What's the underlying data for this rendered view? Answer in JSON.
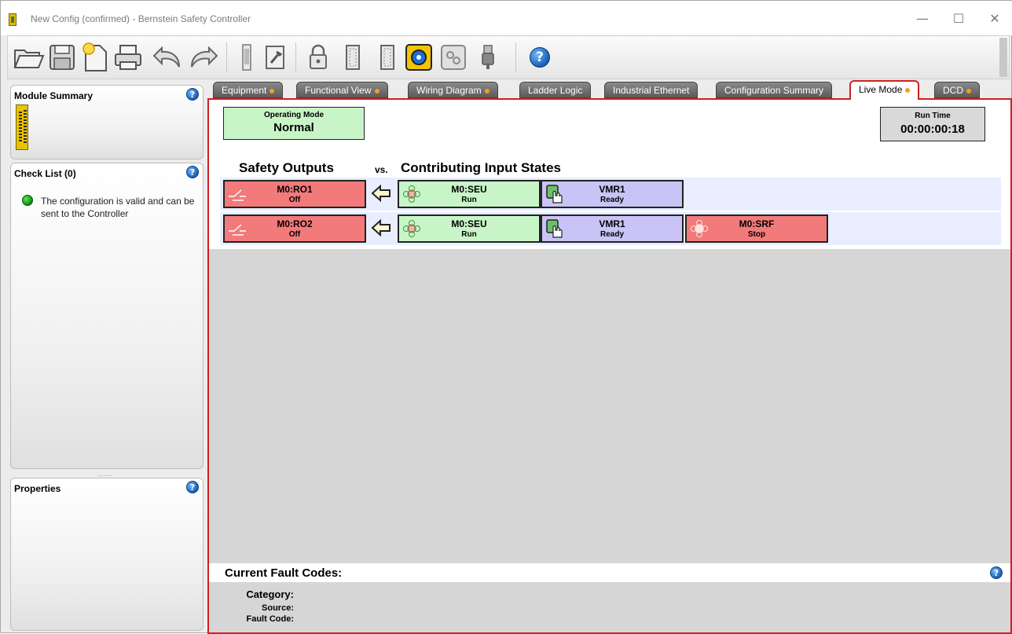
{
  "window": {
    "title": "New Config (confirmed) - Bernstein Safety Controller",
    "minimize": "—",
    "maximize": "☐",
    "close": "✕"
  },
  "toolbar": {
    "help": "?"
  },
  "module_summary": {
    "title": "Module Summary",
    "help": "?"
  },
  "check_list": {
    "title": "Check List (0)",
    "help": "?",
    "status_color": "#19b019",
    "message": "The configuration is valid and can be sent to the Controller"
  },
  "splitter": {
    "grip": "....."
  },
  "properties": {
    "title": "Properties",
    "help": "?"
  },
  "tabs": [
    {
      "label": "Equipment",
      "warn": true
    },
    {
      "label": "Functional View",
      "warn": true
    },
    {
      "label": "Wiring Diagram",
      "warn": true
    },
    {
      "label": "Ladder Logic",
      "warn": false
    },
    {
      "label": "Industrial Ethernet",
      "warn": false
    },
    {
      "label": "Configuration Summary",
      "warn": false
    },
    {
      "label": "Live Mode",
      "warn": true,
      "active": true
    },
    {
      "label": "DCD",
      "warn": true
    }
  ],
  "live": {
    "operating_mode": {
      "label": "Operating Mode",
      "value": "Normal"
    },
    "run_time": {
      "label": "Run Time",
      "value": "00:00:00:18"
    },
    "headers": {
      "outputs": "Safety Outputs",
      "vs": "vs.",
      "inputs": "Contributing Input States"
    },
    "rows": [
      {
        "output": {
          "name": "M0:RO1",
          "state": "Off"
        },
        "inputs": [
          {
            "name": "M0:SEU",
            "state": "Run",
            "color": "green"
          },
          {
            "name": "VMR1",
            "state": "Ready",
            "color": "purple"
          }
        ]
      },
      {
        "output": {
          "name": "M0:RO2",
          "state": "Off"
        },
        "inputs": [
          {
            "name": "M0:SEU",
            "state": "Run",
            "color": "green"
          },
          {
            "name": "VMR1",
            "state": "Ready",
            "color": "purple"
          },
          {
            "name": "M0:SRF",
            "state": "Stop",
            "color": "red"
          }
        ]
      }
    ]
  },
  "fault": {
    "title": "Current Fault Codes:",
    "help": "?",
    "category": "Category:",
    "source": "Source:",
    "code": "Fault Code:"
  }
}
